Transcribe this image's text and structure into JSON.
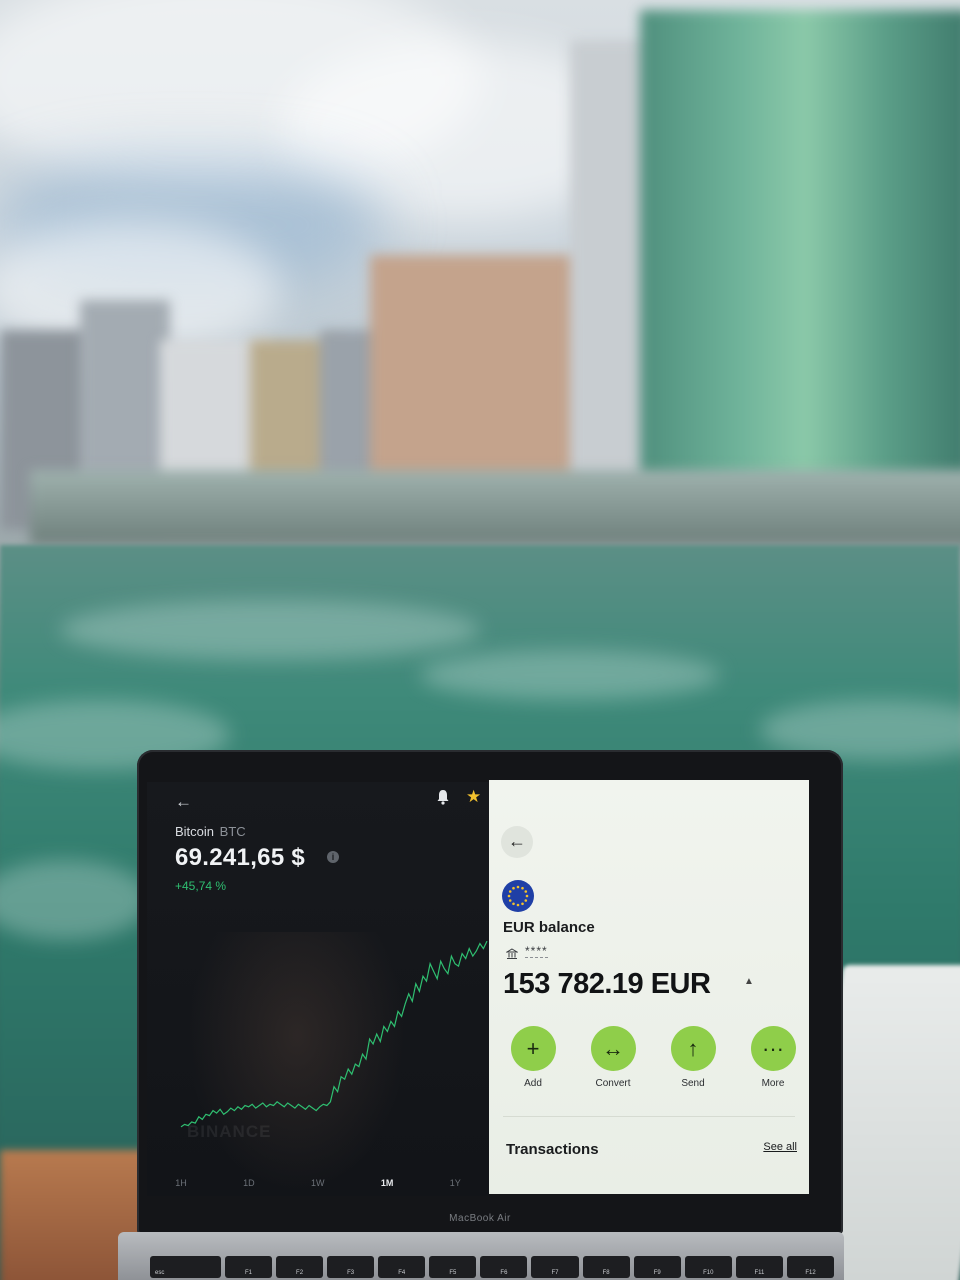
{
  "crypto_app": {
    "coin_name": "Bitcoin",
    "coin_ticker": "BTC",
    "price": "69.241,65 $",
    "change": "+45,74 %",
    "watermark": "BINANCE",
    "ranges": [
      "1H",
      "1D",
      "1W",
      "1M",
      "1Y"
    ],
    "active_range": "1M",
    "info_glyph": "i"
  },
  "chart_data": {
    "type": "line",
    "title": "",
    "xlabel": "",
    "ylabel": "",
    "values": [
      20,
      22,
      21,
      24,
      23,
      28,
      26,
      30,
      29,
      33,
      31,
      34,
      30,
      32,
      35,
      33,
      36,
      34,
      37,
      36,
      38,
      35,
      37,
      39,
      36,
      38,
      37,
      40,
      38,
      36,
      39,
      37,
      35,
      38,
      36,
      34,
      37,
      35,
      33,
      36,
      38,
      37,
      40,
      52,
      48,
      60,
      58,
      66,
      62,
      70,
      68,
      78,
      74,
      90,
      86,
      94,
      88,
      100,
      96,
      104,
      100,
      112,
      108,
      118,
      126,
      120,
      134,
      128,
      140,
      136,
      150,
      144,
      138,
      152,
      146,
      142,
      156,
      150,
      148,
      158,
      154,
      162,
      156,
      160,
      166,
      162,
      168
    ],
    "ylim": [
      0,
      180
    ],
    "line_color": "#2fbf71",
    "grid": false
  },
  "wallet": {
    "balance_title": "EUR balance",
    "masked_account": "****",
    "balance": "153 782.19 EUR",
    "actions": [
      {
        "label": "Add",
        "glyph": "+"
      },
      {
        "label": "Convert",
        "glyph": "↔"
      },
      {
        "label": "Send",
        "glyph": "↑"
      },
      {
        "label": "More",
        "glyph": "···"
      }
    ],
    "transactions_title": "Transactions",
    "see_all": "See all",
    "back_glyph": "←",
    "accent_color": "#8fce4a"
  },
  "laptop": {
    "brand": "MacBook Air",
    "keys": [
      "esc",
      "F1",
      "F2",
      "F3",
      "F4",
      "F5",
      "F6",
      "F7",
      "F8",
      "F9",
      "F10",
      "F11",
      "F12"
    ]
  }
}
